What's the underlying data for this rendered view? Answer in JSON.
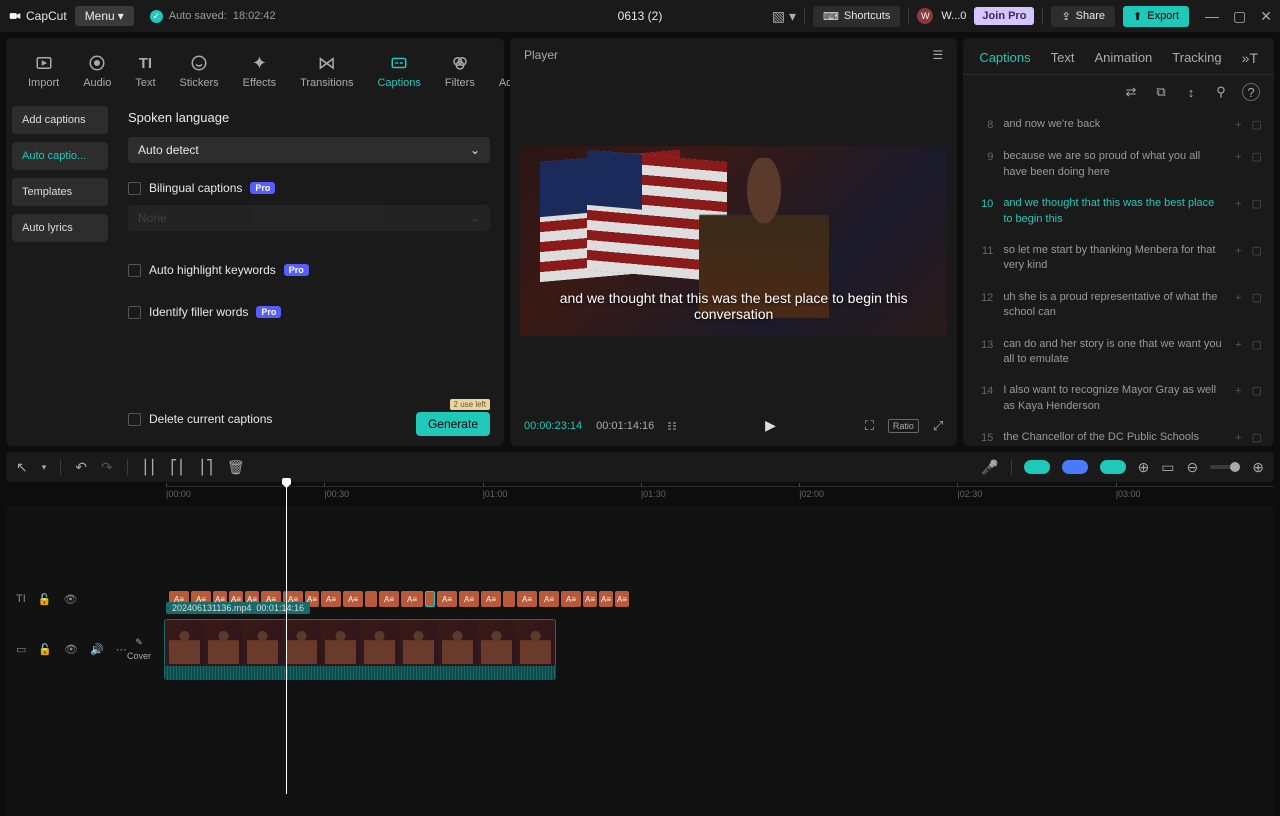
{
  "topbar": {
    "app_name": "CapCut",
    "menu_label": "Menu",
    "autosave_label": "Auto saved:",
    "autosave_time": "18:02:42",
    "project_title": "0613 (2)",
    "shortcuts_label": "Shortcuts",
    "user_initial": "W",
    "user_label": "W...0",
    "join_pro_label": "Join Pro",
    "share_label": "Share",
    "export_label": "Export"
  },
  "media_tabs": {
    "items": [
      {
        "label": "Import"
      },
      {
        "label": "Audio"
      },
      {
        "label": "Text"
      },
      {
        "label": "Stickers"
      },
      {
        "label": "Effects"
      },
      {
        "label": "Transitions"
      },
      {
        "label": "Captions"
      },
      {
        "label": "Filters"
      },
      {
        "label": "Adjustm"
      }
    ],
    "active_index": 6
  },
  "captions_sidebar": {
    "items": [
      {
        "label": "Add captions"
      },
      {
        "label": "Auto captio..."
      },
      {
        "label": "Templates"
      },
      {
        "label": "Auto lyrics"
      }
    ],
    "active_index": 1
  },
  "captions_form": {
    "heading": "Spoken language",
    "language_value": "Auto detect",
    "bilingual_label": "Bilingual captions",
    "bilingual_dropdown": "None",
    "highlight_label": "Auto highlight keywords",
    "filler_label": "Identify filler words",
    "delete_label": "Delete current captions",
    "generate_label": "Generate",
    "use_left_label": "2 use left"
  },
  "player": {
    "header_label": "Player",
    "caption_text": "and we thought that this was the best place to begin this conversation",
    "current_time": "00:00:23:14",
    "total_time": "00:01:14:16",
    "ratio_label": "Ratio"
  },
  "right_tabs": {
    "items": [
      "Captions",
      "Text",
      "Animation",
      "Tracking"
    ],
    "active_index": 0
  },
  "caption_items": [
    {
      "num": "8",
      "text": "and now we're back"
    },
    {
      "num": "9",
      "text": "because we are so proud of what you all have been doing here"
    },
    {
      "num": "10",
      "text": "and we thought that this was the best place to begin this"
    },
    {
      "num": "11",
      "text": "so let me start by thanking Menbera for that very kind"
    },
    {
      "num": "12",
      "text": "uh she is a proud representative of what the school can"
    },
    {
      "num": "13",
      "text": "can do and her story is one that we want you all to emulate"
    },
    {
      "num": "14",
      "text": "I also want to recognize Mayor Gray as well as Kaya Henderson"
    },
    {
      "num": "15",
      "text": "the Chancellor of the DC Public Schools"
    }
  ],
  "caption_active_index": 2,
  "ruler_marks": [
    "00:00",
    "00:30",
    "01:00",
    "01:30",
    "02:00",
    "02:30",
    "03:00"
  ],
  "clip": {
    "filename": "202406131136.mp4",
    "duration": "00:01:14:16"
  },
  "cover_label": "Cover"
}
